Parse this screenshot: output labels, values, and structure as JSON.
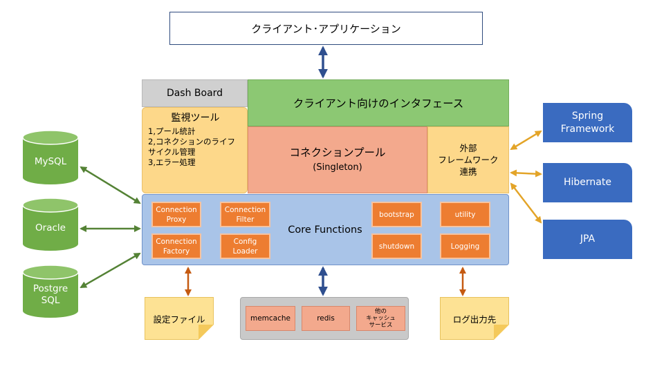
{
  "client_app": "クライアント･アプリケーション",
  "dashboard": "Dash Board",
  "client_interface": "クライアント向けのインタフェース",
  "monitoring": {
    "title": "監視ツール",
    "items": [
      "1,プール統計",
      "2,コネクションのライフ",
      "サイクル管理",
      "3,エラー処理"
    ]
  },
  "connection_pool": {
    "title": "コネクションプール",
    "subtitle": "(Singleton)"
  },
  "external_integration": [
    "外部",
    "フレームワーク",
    "連携"
  ],
  "core": {
    "label": "Core Functions",
    "connection_proxy": [
      "Connection",
      "Proxy"
    ],
    "connection_filter": [
      "Connection",
      "Filter"
    ],
    "connection_factory": [
      "Connection",
      "Factory"
    ],
    "config_loader": [
      "Config",
      "Loader"
    ],
    "bootstrap": "bootstrap",
    "utility": "utility",
    "shutdown": "shutdown",
    "logging": "Logging"
  },
  "databases": {
    "mysql": [
      "MySQL"
    ],
    "oracle": [
      "Oracle"
    ],
    "postgresql": [
      "Postgre",
      "SQL"
    ]
  },
  "frameworks": {
    "spring": [
      "Spring",
      "Framework"
    ],
    "hibernate": [
      "Hibernate"
    ],
    "jpa": [
      "JPA"
    ]
  },
  "config_file": "設定ファイル",
  "log_output": "ログ出力先",
  "cache": {
    "memcache": "memcache",
    "redis": "redis",
    "other": [
      "他の",
      "キャッシュ",
      "サービス"
    ]
  },
  "colors": {
    "arrow_blue": "#2f4f8f",
    "arrow_green": "#548235",
    "arrow_gold": "#e3a428",
    "arrow_orange": "#c55a11",
    "db_green": "#70ad47",
    "framework_blue": "#3a6bc0",
    "core_orange": "#ed7d31"
  }
}
